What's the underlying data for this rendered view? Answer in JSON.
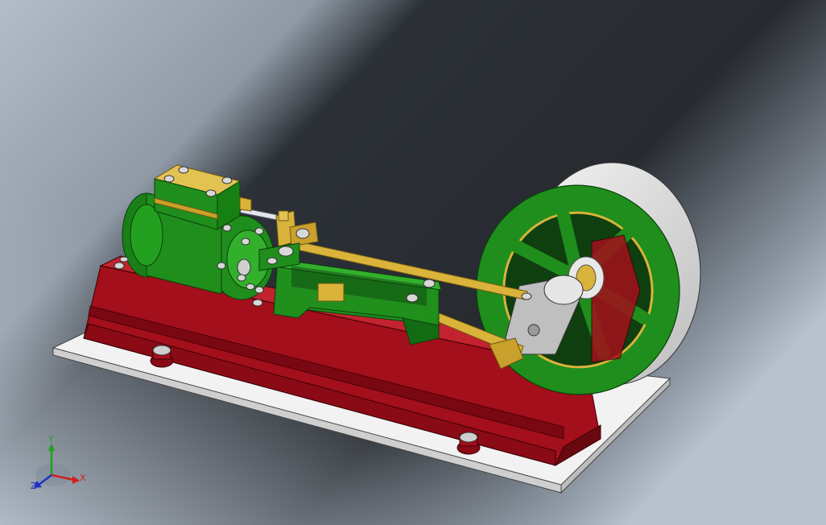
{
  "viewport": {
    "background": {
      "light": "#a9b4c1",
      "dark": "#1f2328",
      "mid": "#3a3f46"
    },
    "model_colors": {
      "base_plate": "#f0f0f0",
      "frame": "#a3101a",
      "frame_dark": "#6a0810",
      "green": "#1f8e1c",
      "green_dark": "#106010",
      "brass": "#d9b33a",
      "brass_dark": "#9a7a1e",
      "steel": "#c8c8c8",
      "rim": "#e6e6e6"
    }
  },
  "triad": {
    "x_label": "X",
    "y_label": "Y",
    "z_label": "Z",
    "x_color": "#d02020",
    "y_color": "#20a020",
    "z_color": "#2030c0"
  }
}
